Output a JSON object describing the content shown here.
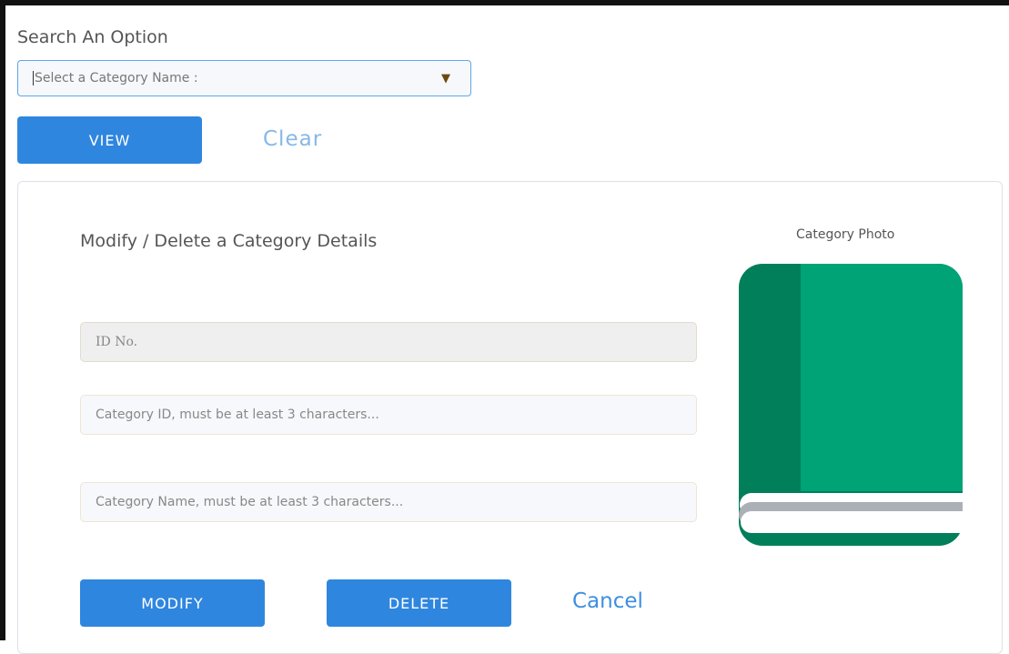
{
  "search": {
    "title": "Search An Option",
    "select_placeholder": "Select a Category Name :",
    "view_label": "VIEW",
    "clear_label": "Clear"
  },
  "panel": {
    "title": "Modify / Delete a Category Details",
    "photo_label": "Category Photo",
    "photo_icon": "book-icon",
    "fields": {
      "id_placeholder": "ID No.",
      "category_id_placeholder": "Category ID, must be at least 3 characters...",
      "category_name_placeholder": "Category Name, must be at least 3 characters..."
    },
    "buttons": {
      "modify_label": "MODIFY",
      "delete_label": "DELETE",
      "cancel_label": "Cancel"
    }
  },
  "colors": {
    "primary_button": "#2f86df",
    "link_light": "#86b8e8",
    "link": "#3d8fe0",
    "book_green": "#00a375",
    "book_spine": "#007f5a"
  }
}
